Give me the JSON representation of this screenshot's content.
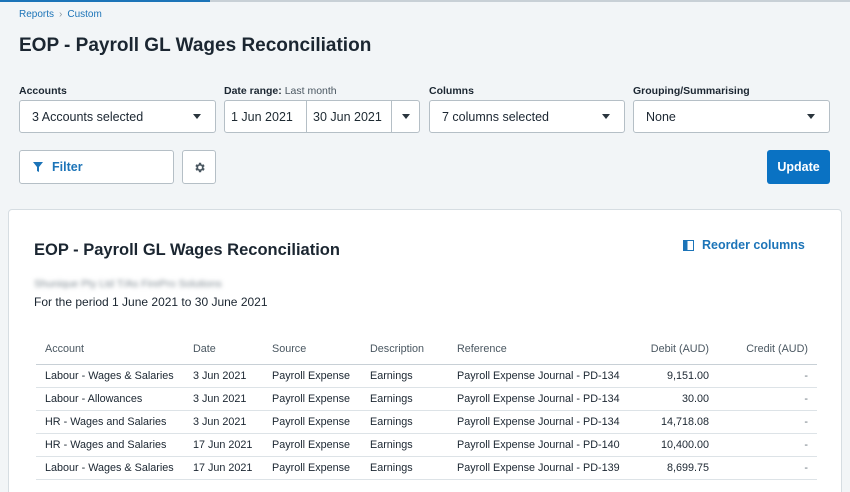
{
  "colors": {
    "accent": "#1c74b8",
    "primary_button": "#0a72c3",
    "top_line_active": "#1c74b8",
    "top_line_rest": "#c8d0d6"
  },
  "breadcrumb": {
    "items": [
      "Reports",
      "Custom"
    ]
  },
  "page_title": "EOP - Payroll GL Wages Reconciliation",
  "controls": {
    "accounts": {
      "label": "Accounts",
      "value": "3 Accounts selected"
    },
    "date_range": {
      "label": "Date range:",
      "preset": "Last month",
      "start": "1 Jun 2021",
      "end": "30 Jun 2021"
    },
    "columns": {
      "label": "Columns",
      "value": "7 columns selected"
    },
    "grouping": {
      "label": "Grouping/Summarising",
      "value": "None"
    },
    "filter_label": "Filter",
    "filter_icon": "funnel-icon",
    "settings_icon": "gear-icon",
    "update_label": "Update"
  },
  "report": {
    "title": "EOP - Payroll GL Wages Reconciliation",
    "reorder_label": "Reorder columns",
    "reorder_icon": "columns-icon",
    "company": "Shunique Pty Ltd T/As FirePro Solutions",
    "period": "For the period 1 June 2021 to 30 June 2021",
    "columns": [
      "Account",
      "Date",
      "Source",
      "Description",
      "Reference",
      "Debit (AUD)",
      "Credit (AUD)"
    ],
    "rows": [
      [
        "Labour - Wages & Salaries",
        "3 Jun 2021",
        "Payroll Expense",
        "Earnings",
        "Payroll Expense Journal - PD-134",
        "9,151.00",
        "-"
      ],
      [
        "Labour - Allowances",
        "3 Jun 2021",
        "Payroll Expense",
        "Earnings",
        "Payroll Expense Journal - PD-134",
        "30.00",
        "-"
      ],
      [
        "HR - Wages and Salaries",
        "3 Jun 2021",
        "Payroll Expense",
        "Earnings",
        "Payroll Expense Journal - PD-134",
        "14,718.08",
        "-"
      ],
      [
        "HR - Wages and Salaries",
        "17 Jun 2021",
        "Payroll Expense",
        "Earnings",
        "Payroll Expense Journal - PD-140",
        "10,400.00",
        "-"
      ],
      [
        "Labour - Wages & Salaries",
        "17 Jun 2021",
        "Payroll Expense",
        "Earnings",
        "Payroll Expense Journal - PD-139",
        "8,699.75",
        "-"
      ]
    ]
  }
}
